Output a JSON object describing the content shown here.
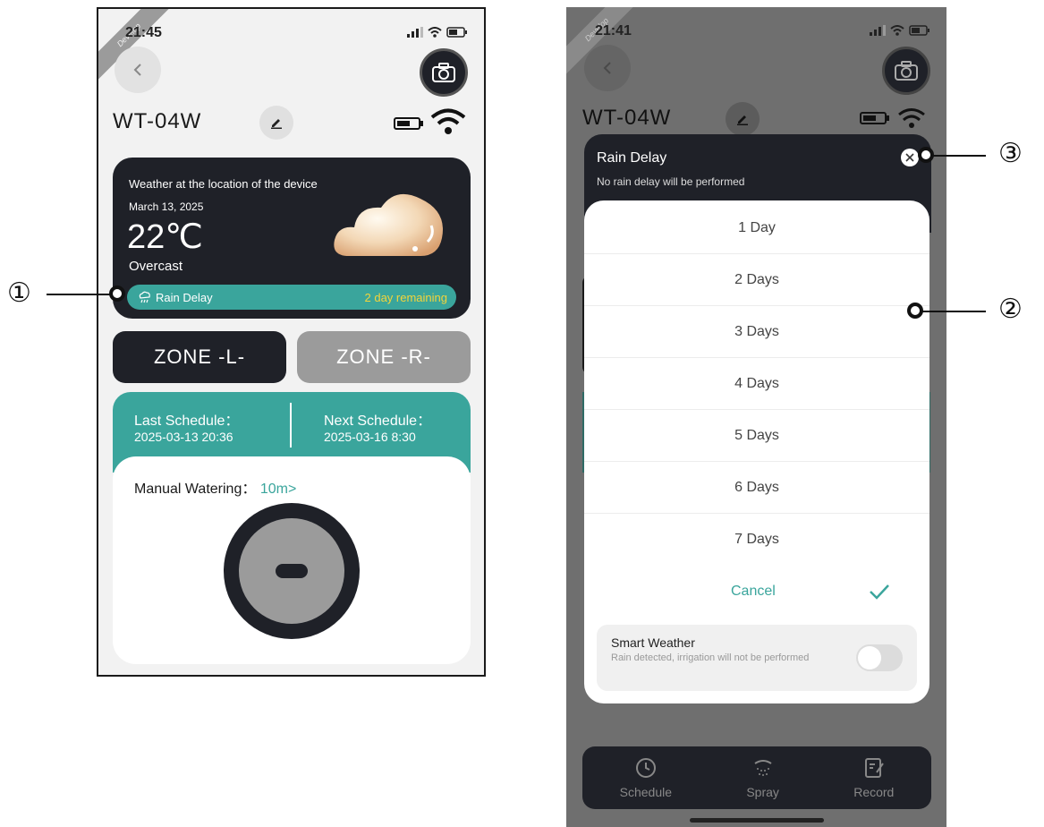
{
  "left": {
    "ribbon": "Develop",
    "time": "21:45",
    "device_name": "WT-04W",
    "weather": {
      "heading": "Weather at the location of the device",
      "date": "March 13, 2025",
      "temperature": "22℃",
      "condition": "Overcast",
      "rain_delay_label": "Rain Delay",
      "rain_delay_remaining": "2 day remaining"
    },
    "zones": [
      "ZONE -L-",
      "ZONE -R-"
    ],
    "schedule": {
      "last_label": "Last Schedule：",
      "last_value": "2025-03-13 20:36",
      "next_label": "Next Schedule：",
      "next_value": "2025-03-16 8:30"
    },
    "manual": {
      "label": "Manual Watering：",
      "value": "10m>"
    }
  },
  "right": {
    "ribbon": "Develop",
    "time": "21:41",
    "device_name": "WT-04W",
    "sheet": {
      "title": "Rain Delay",
      "subtitle": "No rain delay will be performed",
      "options": [
        "1 Day",
        "2 Days",
        "3 Days",
        "4 Days",
        "5 Days",
        "6 Days",
        "7 Days"
      ],
      "cancel": "Cancel",
      "smart_title": "Smart Weather",
      "smart_desc": "Rain detected, irrigation will not be performed"
    },
    "tabs": [
      "Schedule",
      "Spray",
      "Record"
    ]
  },
  "callouts": [
    "①",
    "②",
    "③"
  ],
  "colors": {
    "teal": "#3aa59c",
    "dark": "#1f2128",
    "accent_yellow": "#f3d43a"
  }
}
